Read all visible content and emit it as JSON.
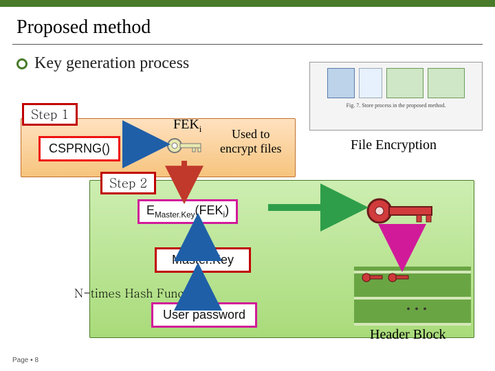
{
  "slide": {
    "title": "Proposed method",
    "subtitle": "Key generation process",
    "footer": "Page ▪ 8"
  },
  "step1": {
    "label": "Step 1",
    "csprng": "CSPRNG()",
    "fek": "FEK",
    "fek_sub": "i",
    "used_to": "Used to\nencrypt files",
    "file_enc": "File Encryption"
  },
  "step2": {
    "label": "Step 2",
    "emk": "E",
    "emk_sub": "Master.Key",
    "emk_arg_open": "(FEK",
    "emk_arg_sub": "i",
    "emk_arg_close": ")",
    "masterkey": "Master.Key",
    "ntimes": "N-times Hash Func",
    "userpwd": "User password",
    "header_block": "Header Block",
    "ellipsis": "..."
  },
  "thumbnail": {
    "caption": "Fig. 7. Store process in the proposed method."
  }
}
